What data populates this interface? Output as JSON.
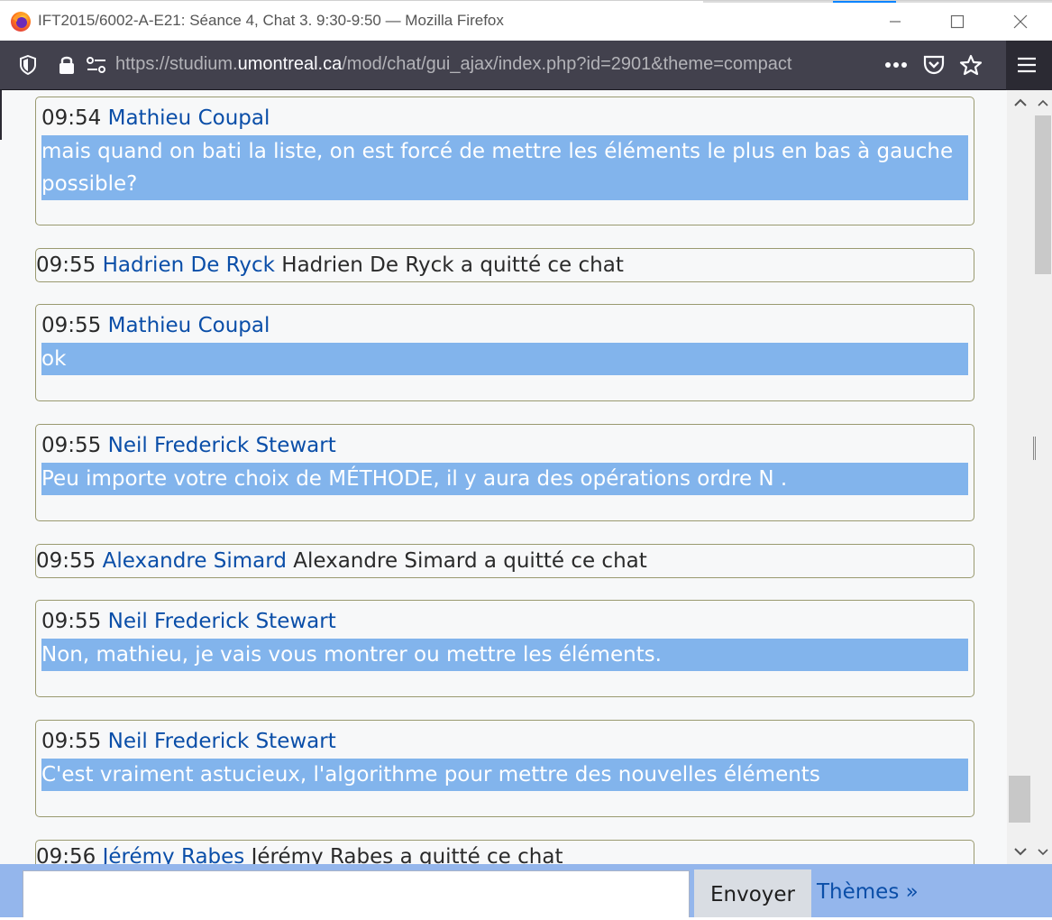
{
  "window": {
    "title": "IFT2015/6002-A-E21: Séance 4, Chat 3. 9:30-9:50 — Mozilla Firefox"
  },
  "navbar": {
    "url_prefix": "https://studium.",
    "url_host": "umontreal.ca",
    "url_path": "/mod/chat/gui_ajax/index.php?id=2901&theme=compact",
    "icons": [
      "shield-icon",
      "lock-icon",
      "permissions-icon",
      "more-actions-icon",
      "pocket-icon",
      "bookmark-star-icon",
      "menu-icon"
    ]
  },
  "messages": [
    {
      "kind": "message",
      "time": "09:54",
      "user": "Mathieu Coupal",
      "text": "mais quand on bati la liste, on est forcé de mettre les éléments le plus en bas à gauche possible?"
    },
    {
      "kind": "system",
      "time": "09:55",
      "user": "Hadrien De Ryck",
      "text": "Hadrien De Ryck a quitté ce chat"
    },
    {
      "kind": "message",
      "time": "09:55",
      "user": "Mathieu Coupal",
      "text": "ok"
    },
    {
      "kind": "message",
      "time": "09:55",
      "user": "Neil Frederick Stewart",
      "text": "Peu importe votre choix de MÉTHODE, il y aura des opérations ordre N ."
    },
    {
      "kind": "system",
      "time": "09:55",
      "user": "Alexandre Simard",
      "text": "Alexandre Simard a quitté ce chat"
    },
    {
      "kind": "message",
      "time": "09:55",
      "user": "Neil Frederick Stewart",
      "text": "Non, mathieu, je vais vous montrer ou mettre les éléments."
    },
    {
      "kind": "message",
      "time": "09:55",
      "user": "Neil Frederick Stewart",
      "text": "C'est vraiment astucieux, l'algorithme pour mettre des nouvelles éléments"
    },
    {
      "kind": "system",
      "time": "09:56",
      "user": "Jérémy Rabes",
      "text": "Jérémy Rabes a quitté ce chat"
    }
  ],
  "chat_input": {
    "value": "",
    "placeholder": ""
  },
  "send_button": {
    "label": "Envoyer"
  },
  "themes_link": {
    "label": "Thèmes »"
  },
  "colors": {
    "user_link": "#0a4ea8",
    "message_highlight": "#82b4ec",
    "input_bar": "#94b6ec",
    "navbar": "#42414d"
  }
}
